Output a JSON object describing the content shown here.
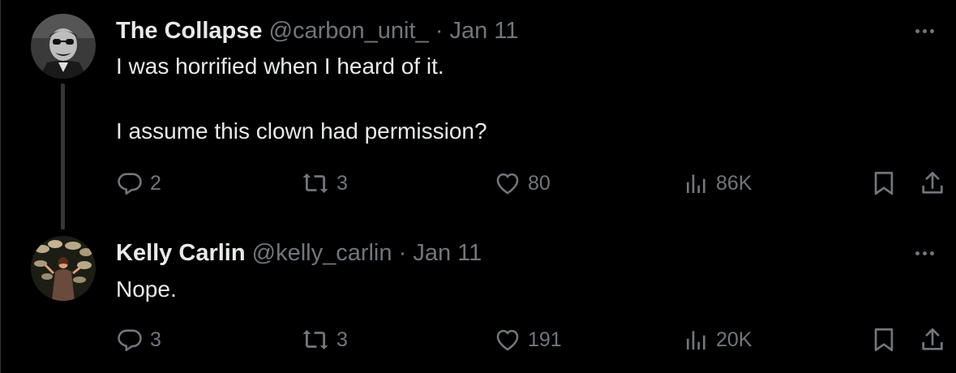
{
  "colors": {
    "background": "#000000",
    "primary_text": "#e7e9ea",
    "secondary_text": "#71767b"
  },
  "tweets": [
    {
      "display_name": "The Collapse",
      "handle": "@carbon_unit_",
      "separator": "·",
      "date": "Jan 11",
      "text": "I was horrified when I heard of it.\n\nI assume this clown had permission?",
      "replies": "2",
      "retweets": "3",
      "likes": "80",
      "views": "86K",
      "avatar_icon": "avatar-grayscale-portrait"
    },
    {
      "display_name": "Kelly Carlin",
      "handle": "@kelly_carlin",
      "separator": "·",
      "date": "Jan 11",
      "text": "Nope.",
      "replies": "3",
      "retweets": "3",
      "likes": "191",
      "views": "20K",
      "avatar_icon": "avatar-stage-clouds"
    }
  ],
  "icons": {
    "reply": "reply-icon",
    "retweet": "retweet-icon",
    "like": "like-icon",
    "views": "views-icon",
    "bookmark": "bookmark-icon",
    "share": "share-icon",
    "more": "more-icon"
  }
}
